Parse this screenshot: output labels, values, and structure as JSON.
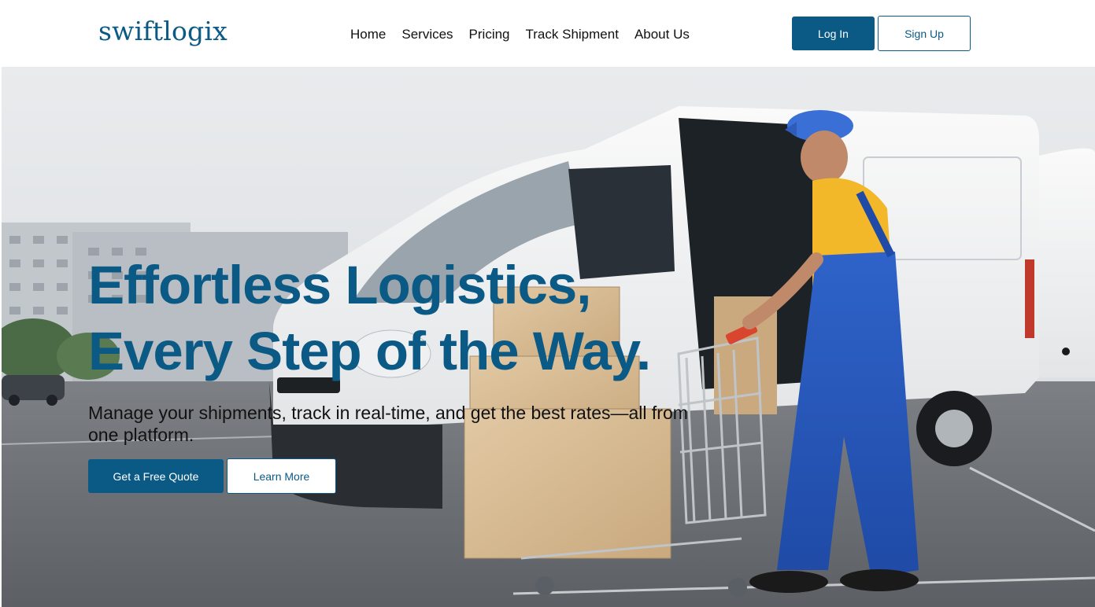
{
  "brand": {
    "logo": "swiftlogix",
    "color": "#0b5a85"
  },
  "nav": {
    "items": [
      {
        "label": "Home"
      },
      {
        "label": "Services"
      },
      {
        "label": "Pricing"
      },
      {
        "label": "Track Shipment"
      },
      {
        "label": "About Us"
      }
    ]
  },
  "auth": {
    "login_label": "Log In",
    "signup_label": "Sign Up"
  },
  "hero": {
    "headline_line1": "Effortless Logistics,",
    "headline_line2": "Every Step of the Way.",
    "subheadline": "Manage your shipments, track in real-time, and get the best rates—all from one platform.",
    "primary_cta": "Get a Free Quote",
    "secondary_cta": "Learn More",
    "image": "delivery-van-worker-with-cart-and-boxes"
  }
}
